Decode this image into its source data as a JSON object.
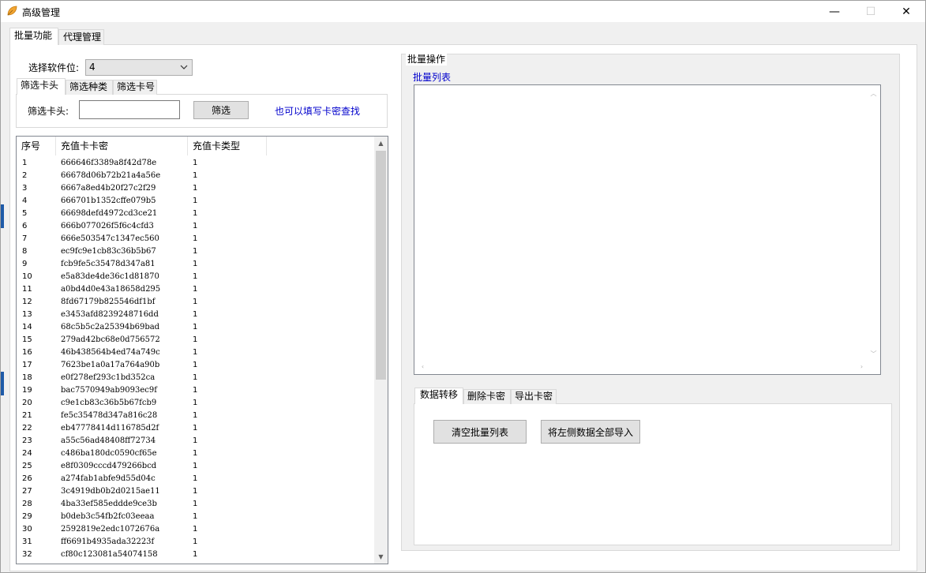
{
  "window": {
    "title": "高级管理",
    "minimize": "—",
    "maximize": "☐",
    "close": "✕"
  },
  "main_tabs": [
    "批量功能",
    "代理管理"
  ],
  "left": {
    "slot_label": "选择软件位:",
    "slot_value": "4",
    "filter_tabs": [
      "筛选卡头",
      "筛选种类",
      "筛选卡号"
    ],
    "filter_label": "筛选卡头:",
    "filter_input": "",
    "filter_button": "筛选",
    "filter_hint": "也可以填写卡密查找",
    "columns": [
      "序号",
      "充值卡卡密",
      "充值卡类型"
    ],
    "rows": [
      [
        "1",
        "666646f3389a8f42d78e",
        "1"
      ],
      [
        "2",
        "66678d06b72b21a4a56e",
        "1"
      ],
      [
        "3",
        "6667a8ed4b20f27c2f29",
        "1"
      ],
      [
        "4",
        "666701b1352cffe079b5",
        "1"
      ],
      [
        "5",
        "66698defd4972cd3ce21",
        "1"
      ],
      [
        "6",
        "666b077026f5f6c4cfd3",
        "1"
      ],
      [
        "7",
        "666e503547c1347ec560",
        "1"
      ],
      [
        "8",
        "ec9fc9e1cb83c36b5b67",
        "1"
      ],
      [
        "9",
        "fcb9fe5c35478d347a81",
        "1"
      ],
      [
        "10",
        "e5a83de4de36c1d81870",
        "1"
      ],
      [
        "11",
        "a0bd4d0e43a18658d295",
        "1"
      ],
      [
        "12",
        "8fd67179b825546df1bf",
        "1"
      ],
      [
        "13",
        "e3453afd8239248716dd",
        "1"
      ],
      [
        "14",
        "68c5b5c2a25394b69bad",
        "1"
      ],
      [
        "15",
        "279ad42bc68e0d756572",
        "1"
      ],
      [
        "16",
        "46b438564b4ed74a749c",
        "1"
      ],
      [
        "17",
        "7623be1a0a17a764a90b",
        "1"
      ],
      [
        "18",
        "e0f278ef293c1bd352ca",
        "1"
      ],
      [
        "19",
        "bac7570949ab9093ec9f",
        "1"
      ],
      [
        "20",
        "c9e1cb83c36b5b67fcb9",
        "1"
      ],
      [
        "21",
        "fe5c35478d347a816c28",
        "1"
      ],
      [
        "22",
        "eb47778414d116785d2f",
        "1"
      ],
      [
        "23",
        "a55c56ad48408ff72734",
        "1"
      ],
      [
        "24",
        "c486ba180dc0590cf65e",
        "1"
      ],
      [
        "25",
        "e8f0309cccd479266bcd",
        "1"
      ],
      [
        "26",
        "a274fab1abfe9d55d04c",
        "1"
      ],
      [
        "27",
        "3c4919db0b2d0215ae11",
        "1"
      ],
      [
        "28",
        "4ba33ef585eddde9ce3b",
        "1"
      ],
      [
        "29",
        "b0deb3c54fb2fc03eeaa",
        "1"
      ],
      [
        "30",
        "2592819e2edc1072676a",
        "1"
      ],
      [
        "31",
        "ff6691b4935ada32223f",
        "1"
      ],
      [
        "32",
        "cf80c123081a54074158",
        "1"
      ]
    ]
  },
  "right": {
    "group_title": "批量操作",
    "list_label": "批量列表",
    "tabs": [
      "数据转移",
      "删除卡密",
      "导出卡密"
    ],
    "clear_button": "清空批量列表",
    "import_button": "将左侧数据全部导入"
  }
}
